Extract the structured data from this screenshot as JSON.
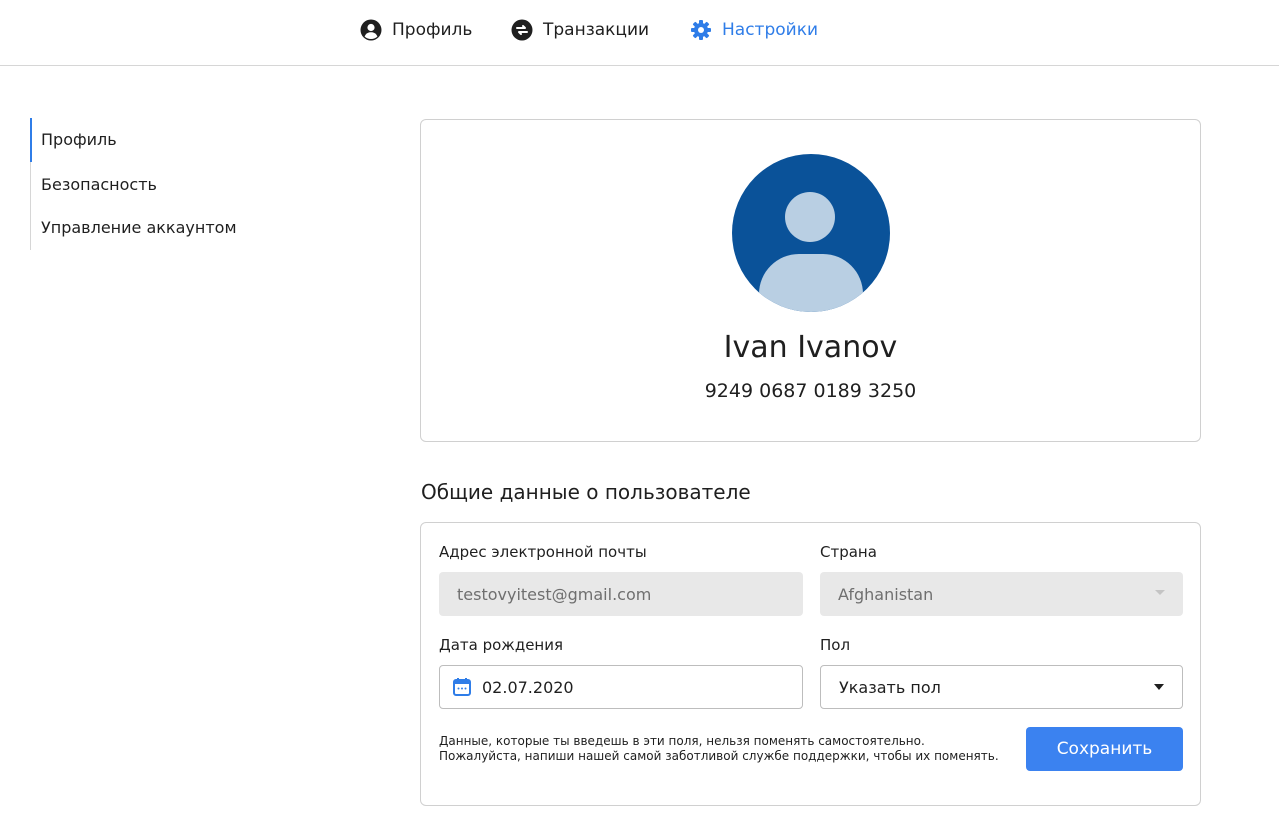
{
  "nav": {
    "items": [
      {
        "label": "Профиль",
        "icon": "user-circle-icon"
      },
      {
        "label": "Транзакции",
        "icon": "exchange-icon"
      },
      {
        "label": "Настройки",
        "icon": "gear-icon",
        "active": true
      }
    ],
    "accent_color": "#2f7de8"
  },
  "sidebar": {
    "items": [
      {
        "label": "Профиль",
        "active": true
      },
      {
        "label": "Безопасность"
      },
      {
        "label": "Управление аккаунтом"
      }
    ]
  },
  "profile": {
    "name": "Ivan Ivanov",
    "card_number": "9249 0687 0189 3250",
    "avatar_color": "#0a5299"
  },
  "form": {
    "title": "Общие данные о пользователе",
    "email_label": "Адрес электронной почты",
    "email_value": "testovyitest@gmail.com",
    "country_label": "Страна",
    "country_value": "Afghanistan",
    "dob_label": "Дата рождения",
    "dob_value": "02.07.2020",
    "gender_label": "Пол",
    "gender_value": "Указать пол",
    "note": "Данные, которые ты введешь в эти поля, нельзя поменять самостоятельно. Пожалуйста, напиши нашей самой заботливой службе поддержки, чтобы их поменять.",
    "save_label": "Сохранить",
    "button_color": "#3b82f0"
  }
}
